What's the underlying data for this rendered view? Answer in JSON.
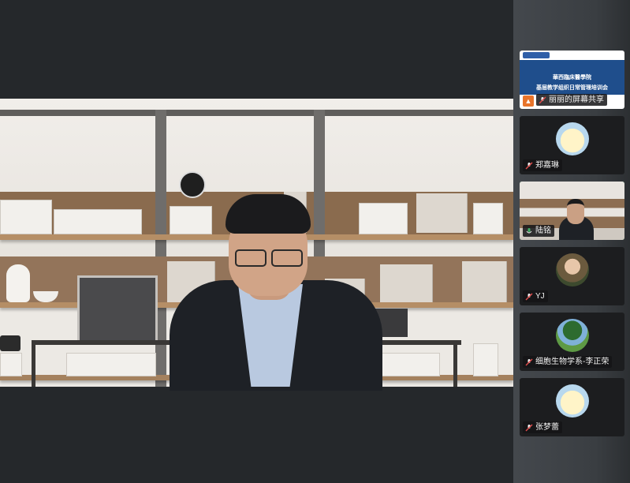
{
  "screen_share": {
    "slide_title_1": "華西臨床醫學院",
    "slide_title_2": "基层教学组织日常管理培训会",
    "label": "丽丽的屏幕共享"
  },
  "participants": [
    {
      "name": "郑嘉琳",
      "avatar": "duck-cartoon-avatar",
      "mic": "muted"
    },
    {
      "name": "陆铭",
      "avatar": "live-video",
      "mic": "active",
      "active_speaker": true
    },
    {
      "name": "YJ",
      "avatar": "flowers-photo-avatar",
      "mic": "muted"
    },
    {
      "name": "细胞生物学系-李正荣",
      "avatar": "tree-photo-avatar",
      "mic": "muted"
    },
    {
      "name": "张梦蕾",
      "avatar": "duck-cartoon-avatar",
      "mic": "muted"
    }
  ],
  "colors": {
    "active_border": "#3fae64",
    "muted_mic": "#e24b4b",
    "share_icon": "#e8742b"
  }
}
